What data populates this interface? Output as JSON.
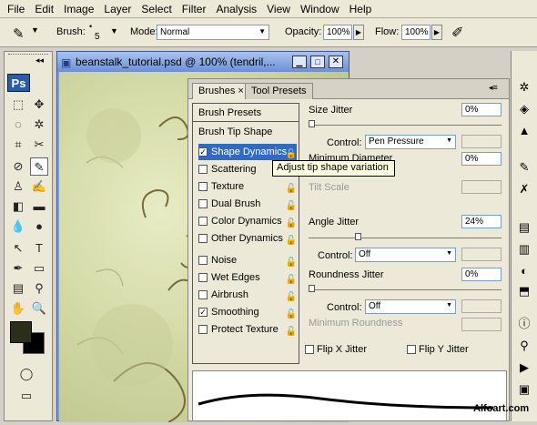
{
  "menu": [
    "File",
    "Edit",
    "Image",
    "Layer",
    "Select",
    "Filter",
    "Analysis",
    "View",
    "Window",
    "Help"
  ],
  "options": {
    "brush_label": "Brush:",
    "brush_size": "5",
    "mode_label": "Mode:",
    "mode_value": "Normal",
    "opacity_label": "Opacity:",
    "opacity_value": "100%",
    "flow_label": "Flow:",
    "flow_value": "100%"
  },
  "toolbox": {
    "logo": "Ps"
  },
  "document": {
    "title": "beanstalk_tutorial.psd @ 100% (tendril,..."
  },
  "panel": {
    "tabs": [
      "Brushes",
      "Tool Presets"
    ],
    "close_glyph": "×",
    "brush_presets": "Brush Presets",
    "brush_tip_shape": "Brush Tip Shape",
    "options": [
      {
        "label": "Shape Dynamics",
        "checked": true
      },
      {
        "label": "Scattering",
        "checked": false
      },
      {
        "label": "Texture",
        "checked": false
      },
      {
        "label": "Dual Brush",
        "checked": false
      },
      {
        "label": "Color Dynamics",
        "checked": false
      },
      {
        "label": "Other Dynamics",
        "checked": false
      },
      {
        "label": "Noise",
        "checked": false
      },
      {
        "label": "Wet Edges",
        "checked": false
      },
      {
        "label": "Airbrush",
        "checked": false
      },
      {
        "label": "Smoothing",
        "checked": true
      },
      {
        "label": "Protect Texture",
        "checked": false
      }
    ],
    "tooltip": "Adjust tip shape variation",
    "size_jitter_label": "Size Jitter",
    "size_jitter_value": "0%",
    "control_label": "Control:",
    "control1_value": "Pen Pressure",
    "min_diameter_label": "Minimum Diameter",
    "min_diameter_value": "0%",
    "tilt_scale_label": "Tilt Scale",
    "angle_jitter_label": "Angle Jitter",
    "angle_jitter_value": "24%",
    "control2_value": "Off",
    "roundness_jitter_label": "Roundness Jitter",
    "roundness_jitter_value": "0%",
    "control3_value": "Off",
    "min_roundness_label": "Minimum Roundness",
    "flip_x_label": "Flip X Jitter",
    "flip_y_label": "Flip Y Jitter"
  },
  "watermark": "Alfoart.com",
  "colors": {
    "accent": "#316ac5",
    "foreground_swatch": "#2b2f1a",
    "background_swatch": "#000000"
  }
}
